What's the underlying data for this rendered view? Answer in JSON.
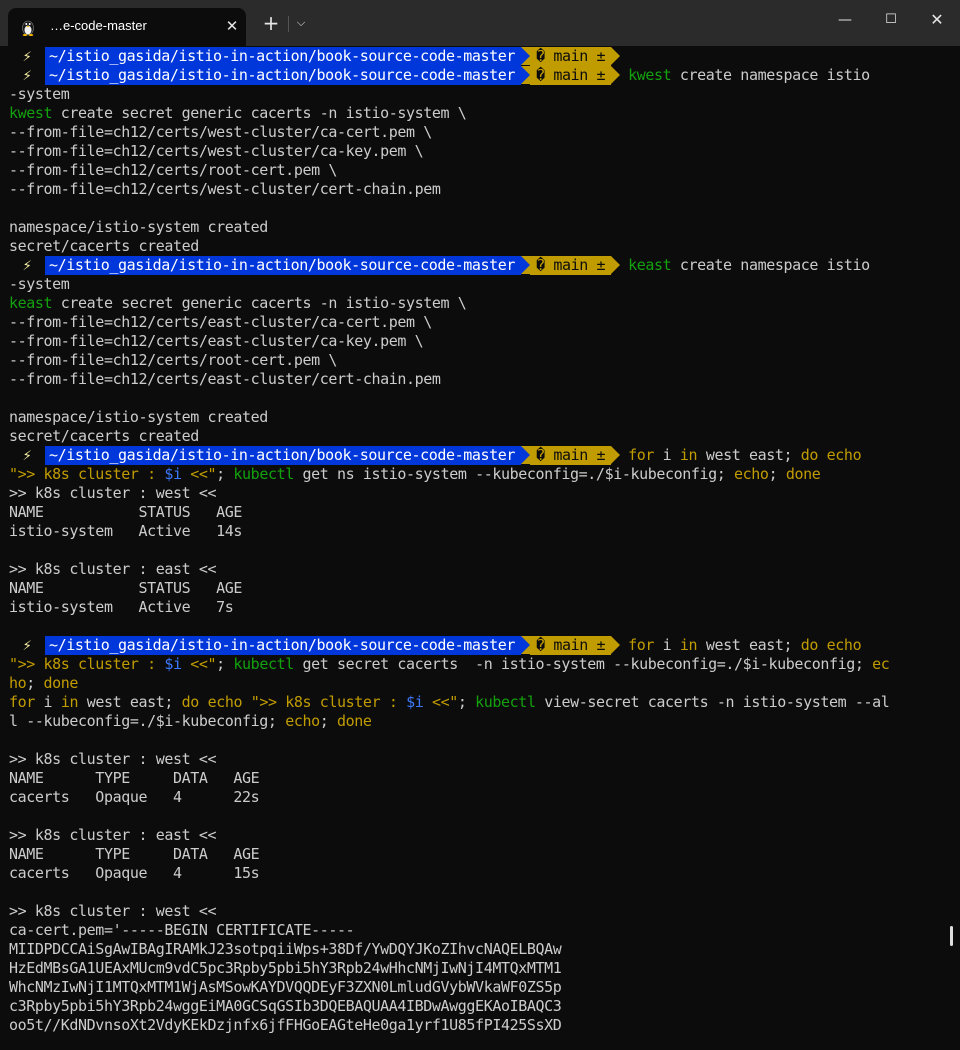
{
  "window": {
    "tab_title": "…e-code-master",
    "tab_icon": "linux-penguin-icon",
    "close_tab_glyph": "✕",
    "new_tab_glyph": "+",
    "dropdown_glyph": "⌵",
    "minimize_glyph": "—",
    "maximize_glyph": "☐",
    "close_glyph": "✕"
  },
  "prompt": {
    "bolt": "⚡",
    "path": "~/istio_gasida/istio-in-action/book-source-code-master",
    "git": "� main ±"
  },
  "colors": {
    "background": "#0c0c0c",
    "path_segment": "#0037da",
    "git_segment": "#c19c00",
    "command_green": "#13a10e",
    "keyword_yellow": "#c19c00",
    "variable_blue": "#3b78ff"
  },
  "lines": [
    {
      "t": "prompt",
      "cmd": []
    },
    {
      "t": "prompt",
      "cmd": [
        [
          "k",
          "kwest"
        ],
        [
          "w",
          " create namespace istio"
        ]
      ]
    },
    {
      "t": "text",
      "s": [
        [
          "w",
          "-system"
        ]
      ]
    },
    {
      "t": "text",
      "s": [
        [
          "k",
          "kwest"
        ],
        [
          "w",
          " create secret generic cacerts -n istio-system \\"
        ]
      ]
    },
    {
      "t": "text",
      "s": [
        [
          "w",
          "--from-file=ch12/certs/west-cluster/ca-cert.pem \\"
        ]
      ]
    },
    {
      "t": "text",
      "s": [
        [
          "w",
          "--from-file=ch12/certs/west-cluster/ca-key.pem \\"
        ]
      ]
    },
    {
      "t": "text",
      "s": [
        [
          "w",
          "--from-file=ch12/certs/root-cert.pem \\"
        ]
      ]
    },
    {
      "t": "text",
      "s": [
        [
          "w",
          "--from-file=ch12/certs/west-cluster/cert-chain.pem"
        ]
      ]
    },
    {
      "t": "text",
      "s": []
    },
    {
      "t": "text",
      "s": [
        [
          "w",
          "namespace/istio-system created"
        ]
      ]
    },
    {
      "t": "text",
      "s": [
        [
          "w",
          "secret/cacerts created"
        ]
      ]
    },
    {
      "t": "prompt",
      "cmd": [
        [
          "k",
          "keast"
        ],
        [
          "w",
          " create namespace istio"
        ]
      ]
    },
    {
      "t": "text",
      "s": [
        [
          "w",
          "-system"
        ]
      ]
    },
    {
      "t": "text",
      "s": [
        [
          "k",
          "keast"
        ],
        [
          "w",
          " create secret generic cacerts -n istio-system \\"
        ]
      ]
    },
    {
      "t": "text",
      "s": [
        [
          "w",
          "--from-file=ch12/certs/east-cluster/ca-cert.pem \\"
        ]
      ]
    },
    {
      "t": "text",
      "s": [
        [
          "w",
          "--from-file=ch12/certs/east-cluster/ca-key.pem \\"
        ]
      ]
    },
    {
      "t": "text",
      "s": [
        [
          "w",
          "--from-file=ch12/certs/root-cert.pem \\"
        ]
      ]
    },
    {
      "t": "text",
      "s": [
        [
          "w",
          "--from-file=ch12/certs/east-cluster/cert-chain.pem"
        ]
      ]
    },
    {
      "t": "text",
      "s": []
    },
    {
      "t": "text",
      "s": [
        [
          "w",
          "namespace/istio-system created"
        ]
      ]
    },
    {
      "t": "text",
      "s": [
        [
          "w",
          "secret/cacerts created"
        ]
      ]
    },
    {
      "t": "prompt",
      "cmd": [
        [
          "y",
          "for"
        ],
        [
          "w",
          " i "
        ],
        [
          "y",
          "in"
        ],
        [
          "w",
          " west east; "
        ],
        [
          "y",
          "do"
        ],
        [
          "w",
          " "
        ],
        [
          "y",
          "echo"
        ]
      ]
    },
    {
      "t": "text",
      "s": [
        [
          "y",
          "\">> k8s cluster : "
        ],
        [
          "b",
          "$i"
        ],
        [
          "y",
          " <<\""
        ],
        [
          "w",
          "; "
        ],
        [
          "k",
          "kubectl"
        ],
        [
          "w",
          " get ns istio-system --kubeconfig=./"
        ],
        [
          "w",
          "$i"
        ],
        [
          "w",
          "-kubeconfig; "
        ],
        [
          "y",
          "echo"
        ],
        [
          "w",
          "; "
        ],
        [
          "y",
          "done"
        ]
      ]
    },
    {
      "t": "text",
      "s": [
        [
          "w",
          ">> k8s cluster : west <<"
        ]
      ]
    },
    {
      "t": "text",
      "s": [
        [
          "w",
          "NAME           STATUS   AGE"
        ]
      ]
    },
    {
      "t": "text",
      "s": [
        [
          "w",
          "istio-system   Active   14s"
        ]
      ]
    },
    {
      "t": "text",
      "s": []
    },
    {
      "t": "text",
      "s": [
        [
          "w",
          ">> k8s cluster : east <<"
        ]
      ]
    },
    {
      "t": "text",
      "s": [
        [
          "w",
          "NAME           STATUS   AGE"
        ]
      ]
    },
    {
      "t": "text",
      "s": [
        [
          "w",
          "istio-system   Active   7s"
        ]
      ]
    },
    {
      "t": "text",
      "s": []
    },
    {
      "t": "prompt",
      "cmd": [
        [
          "y",
          "for"
        ],
        [
          "w",
          " i "
        ],
        [
          "y",
          "in"
        ],
        [
          "w",
          " west east; "
        ],
        [
          "y",
          "do"
        ],
        [
          "w",
          " "
        ],
        [
          "y",
          "echo"
        ]
      ]
    },
    {
      "t": "text",
      "s": [
        [
          "y",
          "\">> k8s cluster : "
        ],
        [
          "b",
          "$i"
        ],
        [
          "y",
          " <<\""
        ],
        [
          "w",
          "; "
        ],
        [
          "k",
          "kubectl"
        ],
        [
          "w",
          " get secret cacerts  -n istio-system --kubeconfig=./$i-kubeconfig; "
        ],
        [
          "y",
          "ec"
        ]
      ]
    },
    {
      "t": "text",
      "s": [
        [
          "y",
          "ho"
        ],
        [
          "w",
          "; "
        ],
        [
          "y",
          "done"
        ]
      ]
    },
    {
      "t": "text",
      "s": [
        [
          "y",
          "for"
        ],
        [
          "w",
          " i "
        ],
        [
          "y",
          "in"
        ],
        [
          "w",
          " west east; "
        ],
        [
          "y",
          "do"
        ],
        [
          "w",
          " "
        ],
        [
          "y",
          "echo"
        ],
        [
          "w",
          " "
        ],
        [
          "y",
          "\">> k8s cluster : "
        ],
        [
          "b",
          "$i"
        ],
        [
          "y",
          " <<\""
        ],
        [
          "w",
          "; "
        ],
        [
          "k",
          "kubectl"
        ],
        [
          "w",
          " view-secret cacerts -n istio-system --al"
        ]
      ]
    },
    {
      "t": "text",
      "s": [
        [
          "w",
          "l --kubeconfig=./$i-kubeconfig; "
        ],
        [
          "y",
          "echo"
        ],
        [
          "w",
          "; "
        ],
        [
          "y",
          "done"
        ]
      ]
    },
    {
      "t": "text",
      "s": []
    },
    {
      "t": "text",
      "s": [
        [
          "w",
          ">> k8s cluster : west <<"
        ]
      ]
    },
    {
      "t": "text",
      "s": [
        [
          "w",
          "NAME      TYPE     DATA   AGE"
        ]
      ]
    },
    {
      "t": "text",
      "s": [
        [
          "w",
          "cacerts   Opaque   4      22s"
        ]
      ]
    },
    {
      "t": "text",
      "s": []
    },
    {
      "t": "text",
      "s": [
        [
          "w",
          ">> k8s cluster : east <<"
        ]
      ]
    },
    {
      "t": "text",
      "s": [
        [
          "w",
          "NAME      TYPE     DATA   AGE"
        ]
      ]
    },
    {
      "t": "text",
      "s": [
        [
          "w",
          "cacerts   Opaque   4      15s"
        ]
      ]
    },
    {
      "t": "text",
      "s": []
    },
    {
      "t": "text",
      "s": [
        [
          "w",
          ">> k8s cluster : west <<"
        ]
      ]
    },
    {
      "t": "text",
      "s": [
        [
          "w",
          "ca-cert.pem='-----BEGIN CERTIFICATE-----"
        ]
      ]
    },
    {
      "t": "text",
      "s": [
        [
          "w",
          "MIIDPDCCAiSgAwIBAgIRAMkJ23sotpqiiWps+38Df/YwDQYJKoZIhvcNAQELBQAw"
        ]
      ]
    },
    {
      "t": "text",
      "s": [
        [
          "w",
          "HzEdMBsGA1UEAxMUcm9vdC5pc3Rpby5pbi5hY3Rpb24wHhcNMjIwNjI4MTQxMTM1"
        ]
      ]
    },
    {
      "t": "text",
      "s": [
        [
          "w",
          "WhcNMzIwNjI1MTQxMTM1WjAsMSowKAYDVQQDEyF3ZXN0LmludGVybWVkaWF0ZS5p"
        ]
      ]
    },
    {
      "t": "text",
      "s": [
        [
          "w",
          "c3Rpby5pbi5hY3Rpb24wggEiMA0GCSqGSIb3DQEBAQUAA4IBDwAwggEKAoIBAQC3"
        ]
      ]
    },
    {
      "t": "text",
      "s": [
        [
          "w",
          "oo5t//KdNDvnsoXt2VdyKEkDzjnfx6jfFHGoEAGteHe0ga1yrf1U85fPI425SsXD"
        ]
      ]
    }
  ]
}
